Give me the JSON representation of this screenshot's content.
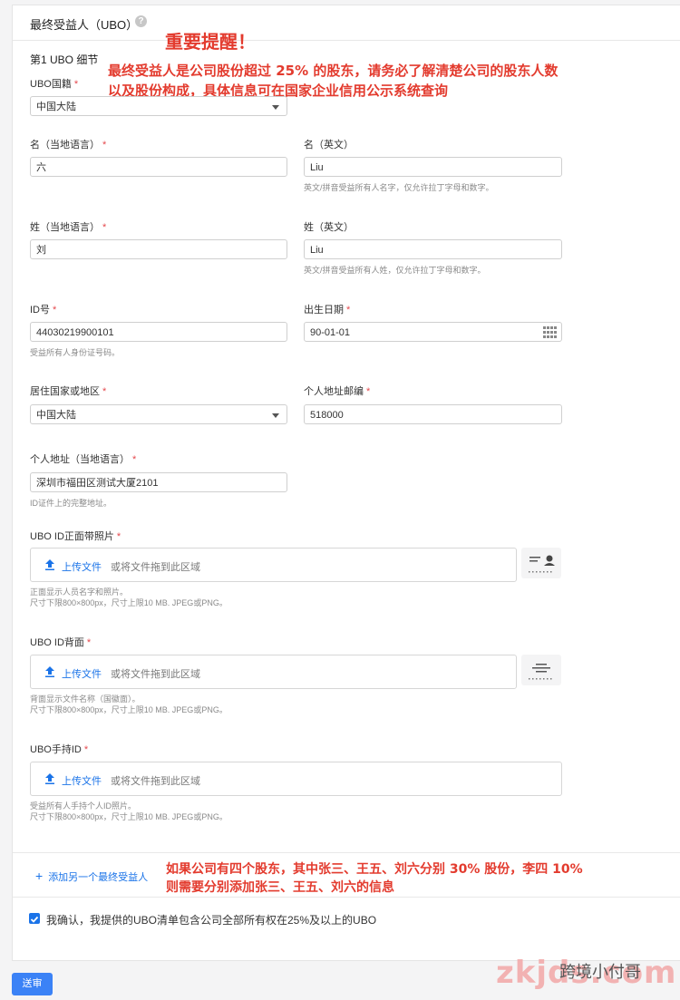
{
  "header": {
    "title": "最终受益人（UBO）",
    "help": "?"
  },
  "annotations": {
    "important_title": "重要提醒！",
    "important_line1": "最终受益人是公司股份超过 25% 的股东，请务必了解清楚公司的股东人数",
    "important_line2": "以及股份构成，具体信息可在国家企业信用公示系统查询",
    "bottom_line1": "如果公司有四个股东，其中张三、王五、刘六分别 30% 股份，李四 10%",
    "bottom_line2": "则需要分别添加张三、王五、刘六的信息"
  },
  "section": {
    "title": "第1 UBO 细节"
  },
  "fields": {
    "nationality": {
      "label": "UBO国籍",
      "value": "中国大陆"
    },
    "first_local": {
      "label": "名（当地语言）",
      "value": "六"
    },
    "first_en": {
      "label": "名（英文）",
      "value": "Liu",
      "hint": "英文/拼音受益所有人名字，仅允许拉丁字母和数字。"
    },
    "last_local": {
      "label": "姓（当地语言）",
      "value": "刘"
    },
    "last_en": {
      "label": "姓（英文）",
      "value": "Liu",
      "hint": "英文/拼音受益所有人姓，仅允许拉丁字母和数字。"
    },
    "id_no": {
      "label": "ID号",
      "value": "44030219900101",
      "hint": "受益所有人身份证号码。"
    },
    "dob": {
      "label": "出生日期",
      "value": "90-01-01"
    },
    "residence": {
      "label": "居住国家或地区",
      "value": "中国大陆"
    },
    "postcode": {
      "label": "个人地址邮编",
      "value": "518000"
    },
    "address": {
      "label": "个人地址（当地语言）",
      "value": "深圳市福田区测试大厦2101",
      "hint": "ID证件上的完整地址。"
    }
  },
  "uploads": {
    "front": {
      "label": "UBO ID正面带照片",
      "hint1": "正面显示人员名字和照片。",
      "hint2": "尺寸下限800×800px，尺寸上限10 MB. JPEG或PNG。"
    },
    "back": {
      "label": "UBO ID背面",
      "hint1": "背面显示文件名称（国徽面）。",
      "hint2": "尺寸下限800×800px，尺寸上限10 MB. JPEG或PNG。"
    },
    "handheld": {
      "label": "UBO手持ID",
      "hint1": "受益所有人手持个人ID照片。",
      "hint2": "尺寸下限800×800px，尺寸上限10 MB. JPEG或PNG。"
    },
    "upload_label": "上传文件",
    "drop_label": "或将文件拖到此区域"
  },
  "add_ubo": "添加另一个最终受益人",
  "confirm_text": "我确认，我提供的UBO清单包含公司全部所有权在25%及以上的UBO",
  "submit": "送审",
  "watermark": {
    "text1": "zkjds.com",
    "text2": "跨境小付哥"
  }
}
